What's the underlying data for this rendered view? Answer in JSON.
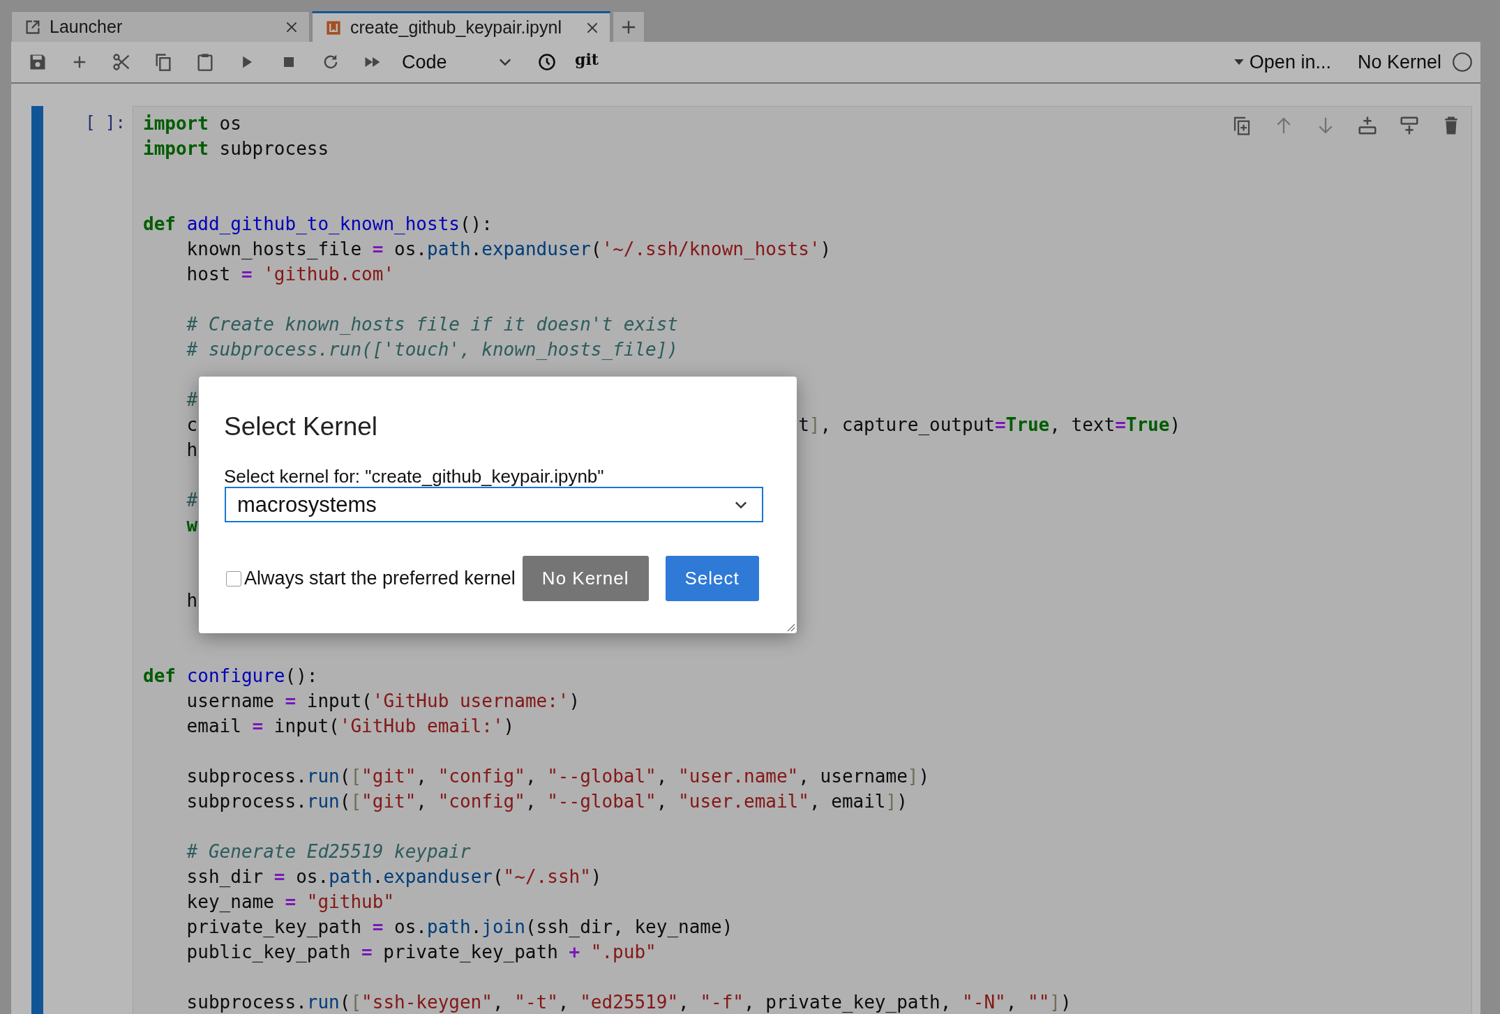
{
  "tabs": [
    {
      "label": "Launcher",
      "kind": "launcher",
      "selected": false
    },
    {
      "label": "create_github_keypair.ipynl",
      "kind": "notebook",
      "selected": true
    }
  ],
  "toolbar": {
    "cell_type": "Code",
    "git": "git",
    "open_in": "Open in...",
    "kernel": "No Kernel"
  },
  "cell": {
    "prompt": "[ ]:",
    "lines": [
      {
        "kind": "code",
        "indented": false,
        "tokens": [
          {
            "text": "import",
            "kind": "keyword"
          },
          {
            "text": " os",
            "kind": "plain"
          }
        ]
      },
      {
        "kind": "code",
        "indented": false,
        "tokens": [
          {
            "text": "import",
            "kind": "keyword"
          },
          {
            "text": " subprocess",
            "kind": "plain"
          }
        ]
      },
      {
        "kind": "blank"
      },
      {
        "kind": "blank"
      },
      {
        "kind": "code",
        "indented": false,
        "tokens": [
          {
            "text": "def ",
            "kind": "keyword"
          },
          {
            "text": "add_github_to_known_hosts",
            "kind": "definition"
          },
          {
            "text": "():",
            "kind": "plain"
          }
        ]
      },
      {
        "kind": "code",
        "indented": true,
        "tokens": [
          {
            "text": "known_hosts_file ",
            "kind": "plain"
          },
          {
            "text": "=",
            "kind": "operator"
          },
          {
            "text": " os.",
            "kind": "plain"
          },
          {
            "text": "path",
            "kind": "property"
          },
          {
            "text": ".",
            "kind": "plain"
          },
          {
            "text": "expanduser",
            "kind": "property"
          },
          {
            "text": "(",
            "kind": "plain"
          },
          {
            "text": "'~/.ssh/known_hosts'",
            "kind": "string"
          },
          {
            "text": ")",
            "kind": "plain"
          }
        ]
      },
      {
        "kind": "code",
        "indented": true,
        "tokens": [
          {
            "text": "host ",
            "kind": "plain"
          },
          {
            "text": "= ",
            "kind": "operator"
          },
          {
            "text": "'github.com'",
            "kind": "string"
          }
        ]
      },
      {
        "kind": "blank"
      },
      {
        "kind": "code",
        "indented": true,
        "tokens": [
          {
            "text": "# Create known_hosts file if it doesn't exist",
            "kind": "comment"
          }
        ]
      },
      {
        "kind": "code",
        "indented": true,
        "tokens": [
          {
            "text": "# subprocess.run(['touch', known_hosts_file])",
            "kind": "comment"
          }
        ]
      },
      {
        "kind": "blank"
      },
      {
        "kind": "covered",
        "indented": true,
        "tokens": [
          {
            "text": "#",
            "kind": "comment"
          }
        ]
      },
      {
        "kind": "covered",
        "indented": true,
        "tokens": [
          {
            "text": "c",
            "kind": "plain"
          }
        ],
        "rest": [
          {
            "text": "t",
            "kind": "plain"
          },
          {
            "text": "]",
            "kind": "bracket"
          },
          {
            "text": ", capture_output",
            "kind": "plain"
          },
          {
            "text": "=",
            "kind": "operator"
          },
          {
            "text": "True",
            "kind": "keyword"
          },
          {
            "text": ", text",
            "kind": "plain"
          },
          {
            "text": "=",
            "kind": "operator"
          },
          {
            "text": "True",
            "kind": "keyword"
          },
          {
            "text": ")",
            "kind": "plain"
          }
        ]
      },
      {
        "kind": "covered",
        "indented": true,
        "tokens": [
          {
            "text": "h",
            "kind": "plain"
          }
        ]
      },
      {
        "kind": "blank"
      },
      {
        "kind": "covered",
        "indented": true,
        "tokens": [
          {
            "text": "#",
            "kind": "comment"
          }
        ]
      },
      {
        "kind": "covered",
        "indented": true,
        "tokens": [
          {
            "text": "w",
            "kind": "keyword"
          }
        ]
      },
      {
        "kind": "blank"
      },
      {
        "kind": "blank"
      },
      {
        "kind": "covered",
        "indented": true,
        "tokens": [
          {
            "text": "h",
            "kind": "plain"
          }
        ]
      },
      {
        "kind": "blank"
      },
      {
        "kind": "blank"
      },
      {
        "kind": "code",
        "indented": false,
        "tokens": [
          {
            "text": "def ",
            "kind": "keyword"
          },
          {
            "text": "configure",
            "kind": "definition"
          },
          {
            "text": "():",
            "kind": "plain"
          }
        ]
      },
      {
        "kind": "code",
        "indented": true,
        "tokens": [
          {
            "text": "username ",
            "kind": "plain"
          },
          {
            "text": "=",
            "kind": "operator"
          },
          {
            "text": " input(",
            "kind": "plain"
          },
          {
            "text": "'GitHub username:'",
            "kind": "string"
          },
          {
            "text": ")",
            "kind": "plain"
          }
        ]
      },
      {
        "kind": "code",
        "indented": true,
        "tokens": [
          {
            "text": "email ",
            "kind": "plain"
          },
          {
            "text": "=",
            "kind": "operator"
          },
          {
            "text": " input(",
            "kind": "plain"
          },
          {
            "text": "'GitHub email:'",
            "kind": "string"
          },
          {
            "text": ")",
            "kind": "plain"
          }
        ]
      },
      {
        "kind": "blank"
      },
      {
        "kind": "code",
        "indented": true,
        "tokens": [
          {
            "text": "subprocess.",
            "kind": "plain"
          },
          {
            "text": "run",
            "kind": "property"
          },
          {
            "text": "(",
            "kind": "plain"
          },
          {
            "text": "[",
            "kind": "bracket"
          },
          {
            "text": "\"git\"",
            "kind": "string"
          },
          {
            "text": ", ",
            "kind": "plain"
          },
          {
            "text": "\"config\"",
            "kind": "string"
          },
          {
            "text": ", ",
            "kind": "plain"
          },
          {
            "text": "\"--global\"",
            "kind": "string"
          },
          {
            "text": ", ",
            "kind": "plain"
          },
          {
            "text": "\"user.name\"",
            "kind": "string"
          },
          {
            "text": ", username",
            "kind": "plain"
          },
          {
            "text": "]",
            "kind": "bracket"
          },
          {
            "text": ")",
            "kind": "plain"
          }
        ]
      },
      {
        "kind": "code",
        "indented": true,
        "tokens": [
          {
            "text": "subprocess.",
            "kind": "plain"
          },
          {
            "text": "run",
            "kind": "property"
          },
          {
            "text": "(",
            "kind": "plain"
          },
          {
            "text": "[",
            "kind": "bracket"
          },
          {
            "text": "\"git\"",
            "kind": "string"
          },
          {
            "text": ", ",
            "kind": "plain"
          },
          {
            "text": "\"config\"",
            "kind": "string"
          },
          {
            "text": ", ",
            "kind": "plain"
          },
          {
            "text": "\"--global\"",
            "kind": "string"
          },
          {
            "text": ", ",
            "kind": "plain"
          },
          {
            "text": "\"user.email\"",
            "kind": "string"
          },
          {
            "text": ", email",
            "kind": "plain"
          },
          {
            "text": "]",
            "kind": "bracket"
          },
          {
            "text": ")",
            "kind": "plain"
          }
        ]
      },
      {
        "kind": "blank"
      },
      {
        "kind": "code",
        "indented": true,
        "tokens": [
          {
            "text": "# Generate Ed25519 keypair",
            "kind": "comment"
          }
        ]
      },
      {
        "kind": "code",
        "indented": true,
        "tokens": [
          {
            "text": "ssh_dir ",
            "kind": "plain"
          },
          {
            "text": "=",
            "kind": "operator"
          },
          {
            "text": " os.",
            "kind": "plain"
          },
          {
            "text": "path",
            "kind": "property"
          },
          {
            "text": ".",
            "kind": "plain"
          },
          {
            "text": "expanduser",
            "kind": "property"
          },
          {
            "text": "(",
            "kind": "plain"
          },
          {
            "text": "\"~/.ssh\"",
            "kind": "string"
          },
          {
            "text": ")",
            "kind": "plain"
          }
        ]
      },
      {
        "kind": "code",
        "indented": true,
        "tokens": [
          {
            "text": "key_name ",
            "kind": "plain"
          },
          {
            "text": "= ",
            "kind": "operator"
          },
          {
            "text": "\"github\"",
            "kind": "string"
          }
        ]
      },
      {
        "kind": "code",
        "indented": true,
        "tokens": [
          {
            "text": "private_key_path ",
            "kind": "plain"
          },
          {
            "text": "=",
            "kind": "operator"
          },
          {
            "text": " os.",
            "kind": "plain"
          },
          {
            "text": "path",
            "kind": "property"
          },
          {
            "text": ".",
            "kind": "plain"
          },
          {
            "text": "join",
            "kind": "property"
          },
          {
            "text": "(ssh_dir, key_name)",
            "kind": "plain"
          }
        ]
      },
      {
        "kind": "code",
        "indented": true,
        "tokens": [
          {
            "text": "public_key_path ",
            "kind": "plain"
          },
          {
            "text": "=",
            "kind": "operator"
          },
          {
            "text": " private_key_path ",
            "kind": "plain"
          },
          {
            "text": "+ ",
            "kind": "operator"
          },
          {
            "text": "\".pub\"",
            "kind": "string"
          }
        ]
      },
      {
        "kind": "blank"
      },
      {
        "kind": "code",
        "indented": true,
        "tokens": [
          {
            "text": "subprocess.",
            "kind": "plain"
          },
          {
            "text": "run",
            "kind": "property"
          },
          {
            "text": "(",
            "kind": "plain"
          },
          {
            "text": "[",
            "kind": "bracket"
          },
          {
            "text": "\"ssh-keygen\"",
            "kind": "string"
          },
          {
            "text": ", ",
            "kind": "plain"
          },
          {
            "text": "\"-t\"",
            "kind": "string"
          },
          {
            "text": ", ",
            "kind": "plain"
          },
          {
            "text": "\"ed25519\"",
            "kind": "string"
          },
          {
            "text": ", ",
            "kind": "plain"
          },
          {
            "text": "\"-f\"",
            "kind": "string"
          },
          {
            "text": ", private_key_path, ",
            "kind": "plain"
          },
          {
            "text": "\"-N\"",
            "kind": "string"
          },
          {
            "text": ", ",
            "kind": "plain"
          },
          {
            "text": "\"\"",
            "kind": "string"
          },
          {
            "text": "]",
            "kind": "bracket"
          },
          {
            "text": ")",
            "kind": "plain"
          }
        ]
      }
    ]
  },
  "dialog": {
    "title": "Select Kernel",
    "label": "Select kernel for: \"create_github_keypair.ipynb\"",
    "kernel": "macrosystems",
    "checkbox": {
      "label": "Always start the preferred kernel",
      "checked": false
    },
    "buttons": [
      {
        "label": "No Kernel",
        "kind": "secondary"
      },
      {
        "label": "Select",
        "kind": "primary"
      }
    ]
  }
}
